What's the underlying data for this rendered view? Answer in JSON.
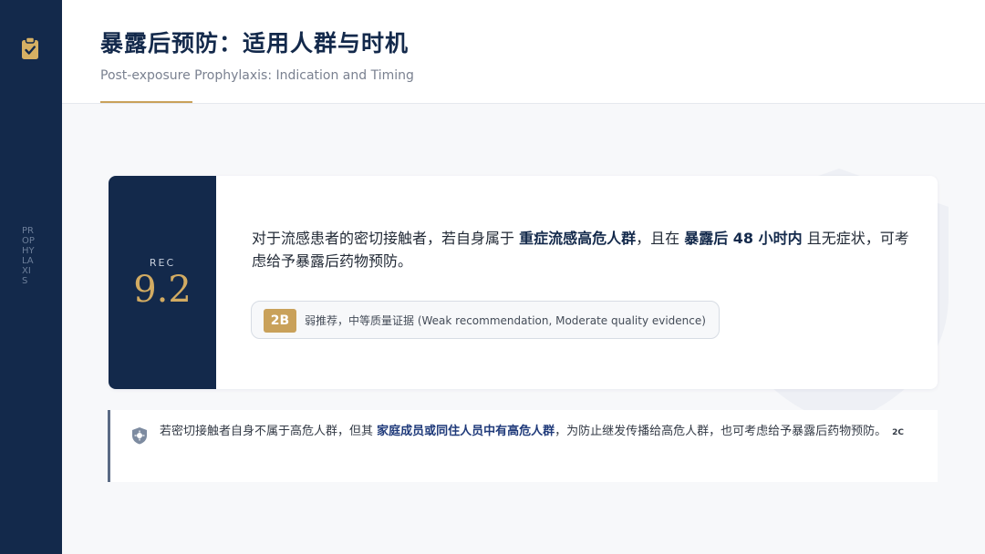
{
  "sidebar": {
    "vertical_text": "PROPHYLAXIS",
    "icon": "clipboard-check-icon"
  },
  "header": {
    "title": "暴露后预防：适用人群与时机",
    "subtitle": "Post-exposure Prophylaxis: Indication and Timing"
  },
  "recommendation": {
    "label": "REC",
    "number": "9.2",
    "text_part1": "对于流感患者的密切接触者，若自身属于 ",
    "bold1": "重症流感高危人群",
    "text_part2": "，且在 ",
    "bold2": "暴露后 48 小时内",
    "text_part3": " 且无症状，可考虑给予暴露后药物预防。",
    "grade": "2B",
    "grade_desc": "弱推荐，中等质量证据 (Weak recommendation, Moderate quality evidence)"
  },
  "note": {
    "icon": "shield-virus-icon",
    "text_part1": "若密切接触者自身不属于高危人群，但其 ",
    "bold": "家庭成员或同住人员中有高危人群",
    "text_part2": "，为防止继发传播给高危人群，也可考虑给予暴露后药物预防。",
    "grade": "2C"
  },
  "colors": {
    "navy": "#13294b",
    "gold": "#c9a15a",
    "background": "#f7f8fa"
  }
}
